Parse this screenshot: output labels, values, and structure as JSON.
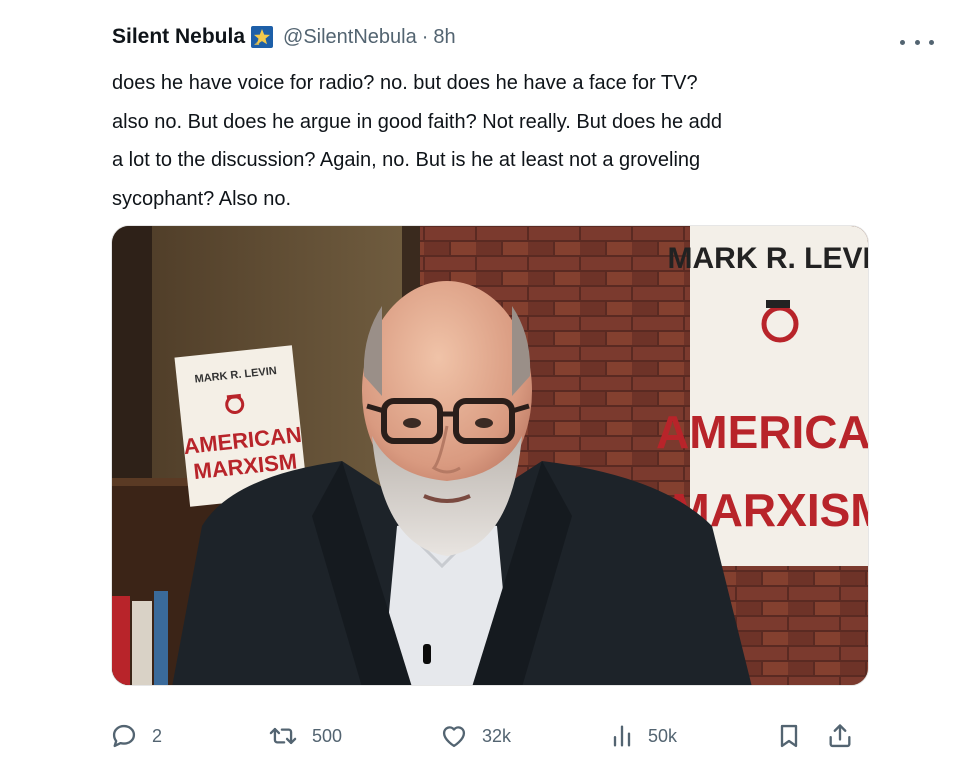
{
  "tweet": {
    "display_name": "Silent Nebula",
    "handle": "@SilentNebula",
    "separator": "·",
    "timestamp": "8h",
    "badge_icon": "star-badge-icon",
    "more_icon": "more-options-icon",
    "text": "does he have voice for radio? no. but does he have a face for TV?\nalso no. But does he argue in good faith? Not really. But does he add\na lot to the discussion? Again, no. But is he at least not a groveling\nsycophant? Also no."
  },
  "media": {
    "book_left": {
      "author": "MARK R. LEVIN",
      "title_line1": "AMERICAN",
      "title_line2": "MARXISM"
    },
    "banner_right": {
      "author": "MARK R. LEVIN",
      "title_line1": "AMERICAN",
      "title_line2": "MARXISM"
    }
  },
  "actions": {
    "reply": {
      "icon": "reply-icon",
      "count": "2"
    },
    "retweet": {
      "icon": "retweet-icon",
      "count": "500"
    },
    "like": {
      "icon": "heart-icon",
      "count": "32k"
    },
    "views": {
      "icon": "views-icon",
      "count": "50k"
    },
    "bookmark": {
      "icon": "bookmark-icon"
    },
    "share": {
      "icon": "share-icon"
    }
  },
  "colors": {
    "text": "#0f1419",
    "secondary": "#536471",
    "badge_bg": "#1d5fa8",
    "badge_star": "#f2c94c",
    "poster_red": "#b8242a"
  }
}
